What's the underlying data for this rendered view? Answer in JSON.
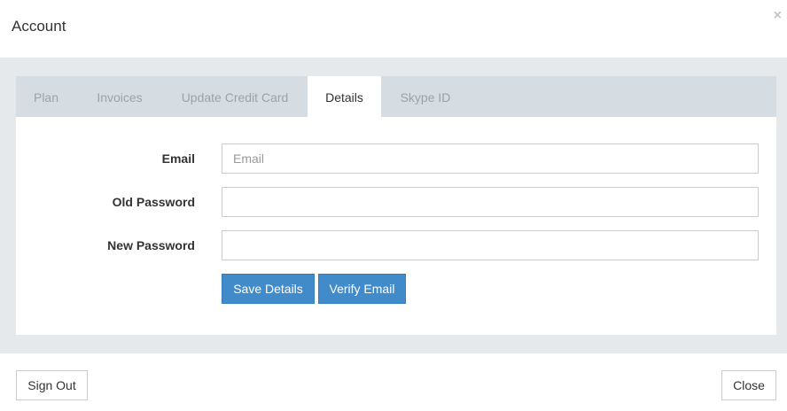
{
  "header": {
    "title": "Account",
    "close_glyph": "×",
    "close_icon": "close-icon"
  },
  "tabs": [
    {
      "label": "Plan",
      "active": false
    },
    {
      "label": "Invoices",
      "active": false
    },
    {
      "label": "Update Credit Card",
      "active": false
    },
    {
      "label": "Details",
      "active": true
    },
    {
      "label": "Skype ID",
      "active": false
    }
  ],
  "form": {
    "email": {
      "label": "Email",
      "value": "",
      "placeholder": "Email"
    },
    "old_password": {
      "label": "Old Password",
      "value": "",
      "placeholder": ""
    },
    "new_password": {
      "label": "New Password",
      "value": "",
      "placeholder": ""
    },
    "save_label": "Save Details",
    "verify_label": "Verify Email"
  },
  "footer": {
    "sign_out_label": "Sign Out",
    "close_label": "Close"
  },
  "colors": {
    "primary": "#428bca",
    "body_bg": "#e6e9ec",
    "tabs_bg": "#d5dde3",
    "inactive_tab_text": "#9aa3aa"
  }
}
